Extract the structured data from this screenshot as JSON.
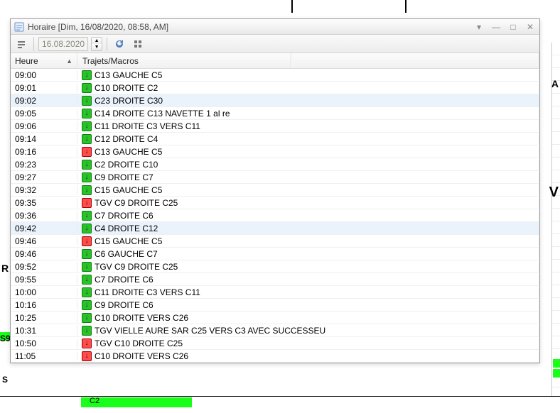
{
  "window": {
    "title": "Horaire [Dim, 16/08/2020, 08:58, AM]"
  },
  "toolbar": {
    "date_value": "16.08.2020"
  },
  "columns": {
    "time": "Heure",
    "route": "Trajets/Macros"
  },
  "rows": [
    {
      "time": "09:00",
      "icon": "green",
      "label": "C13 GAUCHE C5"
    },
    {
      "time": "09:01",
      "icon": "green",
      "label": "C10 DROITE C2"
    },
    {
      "time": "09:02",
      "icon": "green",
      "label": "C23 DROITE C30",
      "selected": true
    },
    {
      "time": "09:05",
      "icon": "green",
      "label": "C14  DROITE C13  NAVETTE 1 al re"
    },
    {
      "time": "09:06",
      "icon": "green",
      "label": "C11 DROITE  C3   VERS C11"
    },
    {
      "time": "09:14",
      "icon": "green",
      "label": "C12 DROITE C4"
    },
    {
      "time": "09:16",
      "icon": "red",
      "label": "C13 GAUCHE C5"
    },
    {
      "time": "09:23",
      "icon": "green",
      "label": "C2 DROITE C10"
    },
    {
      "time": "09:27",
      "icon": "green",
      "label": "C9 DROITE C7"
    },
    {
      "time": "09:32",
      "icon": "green",
      "label": "C15 GAUCHE C5"
    },
    {
      "time": "09:35",
      "icon": "red",
      "label": "TGV  C9  DROITE C25"
    },
    {
      "time": "09:36",
      "icon": "green",
      "label": "C7 DROITE C6"
    },
    {
      "time": "09:42",
      "icon": "green",
      "label": "C4 DROITE C12",
      "selected": true
    },
    {
      "time": "09:46",
      "icon": "red",
      "label": "C15 GAUCHE C5"
    },
    {
      "time": "09:46",
      "icon": "green",
      "label": "C6 GAUCHE C7"
    },
    {
      "time": "09:52",
      "icon": "green",
      "label": "TGV  C9  DROITE C25"
    },
    {
      "time": "09:55",
      "icon": "green",
      "label": "C7 DROITE C6"
    },
    {
      "time": "10:00",
      "icon": "green",
      "label": "C11 DROITE  C3   VERS C11"
    },
    {
      "time": "10:16",
      "icon": "green",
      "label": "C9 DROITE C6"
    },
    {
      "time": "10:25",
      "icon": "green",
      "label": "C10 DROITE VERS C26"
    },
    {
      "time": "10:31",
      "icon": "green",
      "label": "TGV VIELLE AURE SAR C25 VERS C3 AVEC SUCCESSEU"
    },
    {
      "time": "10:50",
      "icon": "red",
      "label": "TGV  C10  DROITE C25"
    },
    {
      "time": "11:05",
      "icon": "red",
      "label": "C10 DROITE VERS C26"
    }
  ],
  "background": {
    "left_labels": {
      "r": "R",
      "s9": "S9",
      "s": "S"
    },
    "right_labels": {
      "a": "A",
      "v": "V"
    },
    "ruler_label": "C2"
  }
}
